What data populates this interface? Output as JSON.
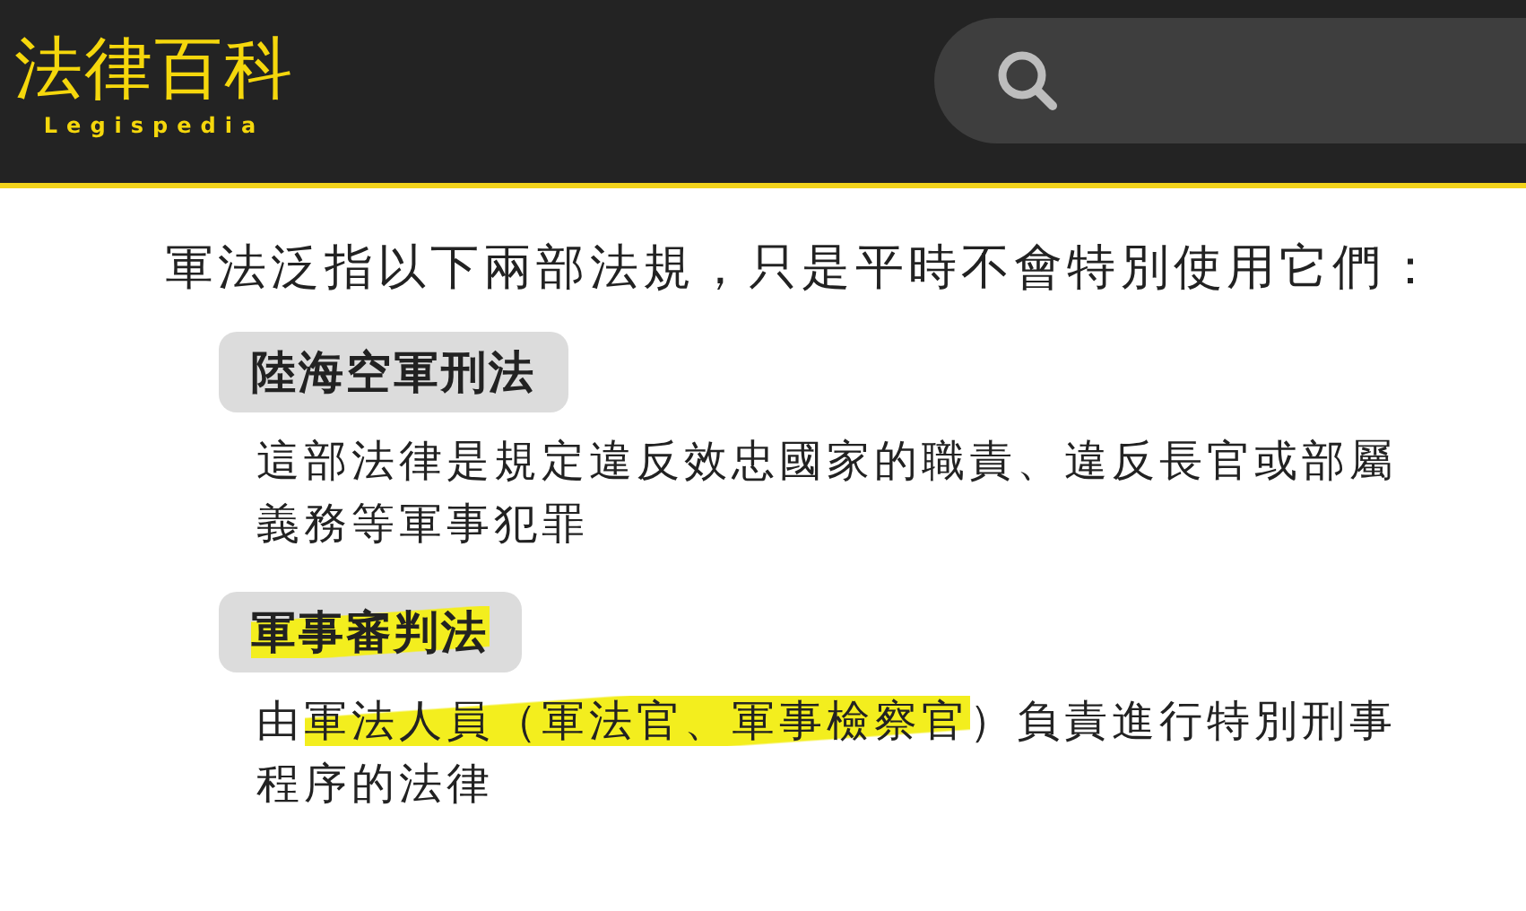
{
  "header": {
    "logo": "法律百科",
    "logo_subtitle": "Legispedia"
  },
  "intro": "軍法泛指以下兩部法規，只是平時不會特別使用它們：",
  "sections": [
    {
      "title": "陸海空軍刑法",
      "title_highlighted": false,
      "description": [
        {
          "text": "這部法律是規定違反效忠國家的職責、違反長官或部屬義務等軍事犯罪",
          "highlighted": false
        }
      ]
    },
    {
      "title": "軍事審判法",
      "title_highlighted": true,
      "description": [
        {
          "text": "由",
          "highlighted": false
        },
        {
          "text": "軍法人員（軍法官、軍事檢察官",
          "highlighted": true
        },
        {
          "text": "）負責進行特別刑事程序的法律",
          "highlighted": false
        }
      ]
    }
  ]
}
